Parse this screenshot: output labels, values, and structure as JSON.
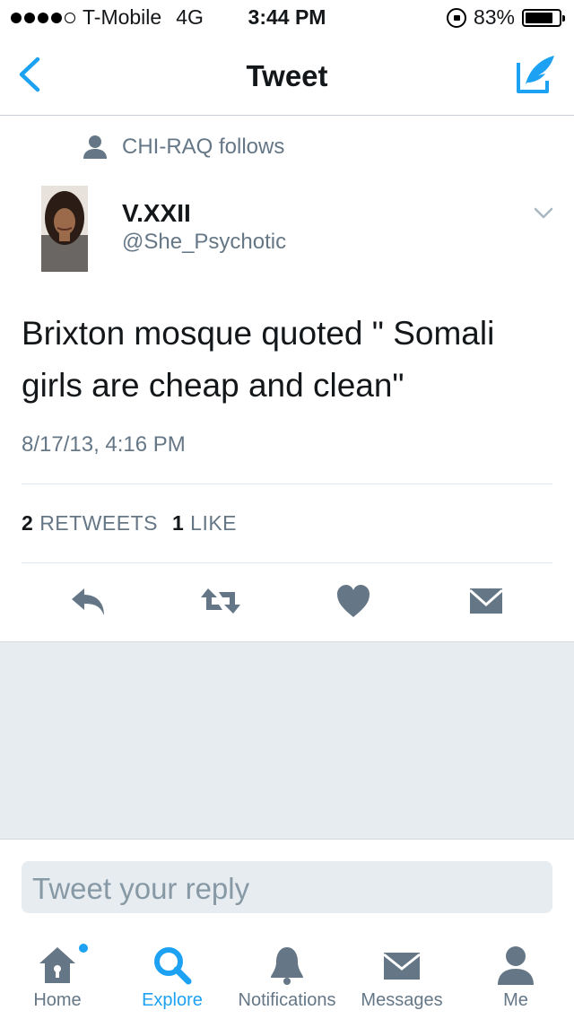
{
  "status_bar": {
    "carrier": "T-Mobile",
    "network": "4G",
    "time": "3:44 PM",
    "battery": "83%",
    "battery_level": 0.83
  },
  "nav": {
    "title": "Tweet"
  },
  "context": {
    "text": "CHI-RAQ follows"
  },
  "tweet": {
    "user_name": "V.XXII",
    "user_handle": "@She_Psychotic",
    "text": "Brixton mosque quoted \" Somali girls are cheap and clean\"",
    "timestamp": "8/17/13, 4:16 PM",
    "retweets_count": "2",
    "retweets_label": "RETWEETS",
    "likes_count": "1",
    "likes_label": "LIKE"
  },
  "reply": {
    "placeholder": "Tweet your reply"
  },
  "tabs": [
    {
      "label": "Home"
    },
    {
      "label": "Explore"
    },
    {
      "label": "Notifications"
    },
    {
      "label": "Messages"
    },
    {
      "label": "Me"
    }
  ],
  "colors": {
    "accent": "#1da1f2",
    "icon_gray": "#657786",
    "background_gray": "#e6ecf0"
  }
}
